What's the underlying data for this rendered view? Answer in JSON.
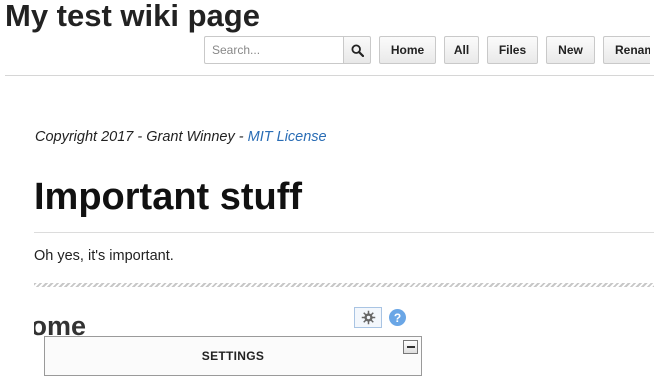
{
  "header": {
    "site_title": "My test wiki page"
  },
  "toolbar": {
    "search_placeholder": "Search...",
    "buttons": [
      {
        "label": "Home"
      },
      {
        "label": "All"
      },
      {
        "label": "Files"
      },
      {
        "label": "New"
      },
      {
        "label": "Renam"
      }
    ]
  },
  "content": {
    "copyright_prefix": "Copyright 2017 - Grant Winney - ",
    "license_link": "MIT License",
    "heading": "Important stuff",
    "paragraph": "Oh yes, it's important.",
    "partial_heading": "rome"
  },
  "widget": {
    "help_label": "?",
    "settings_title": "SETTINGS"
  },
  "colors": {
    "link": "#2a6db5",
    "help_icon": "#6aa6e6"
  }
}
